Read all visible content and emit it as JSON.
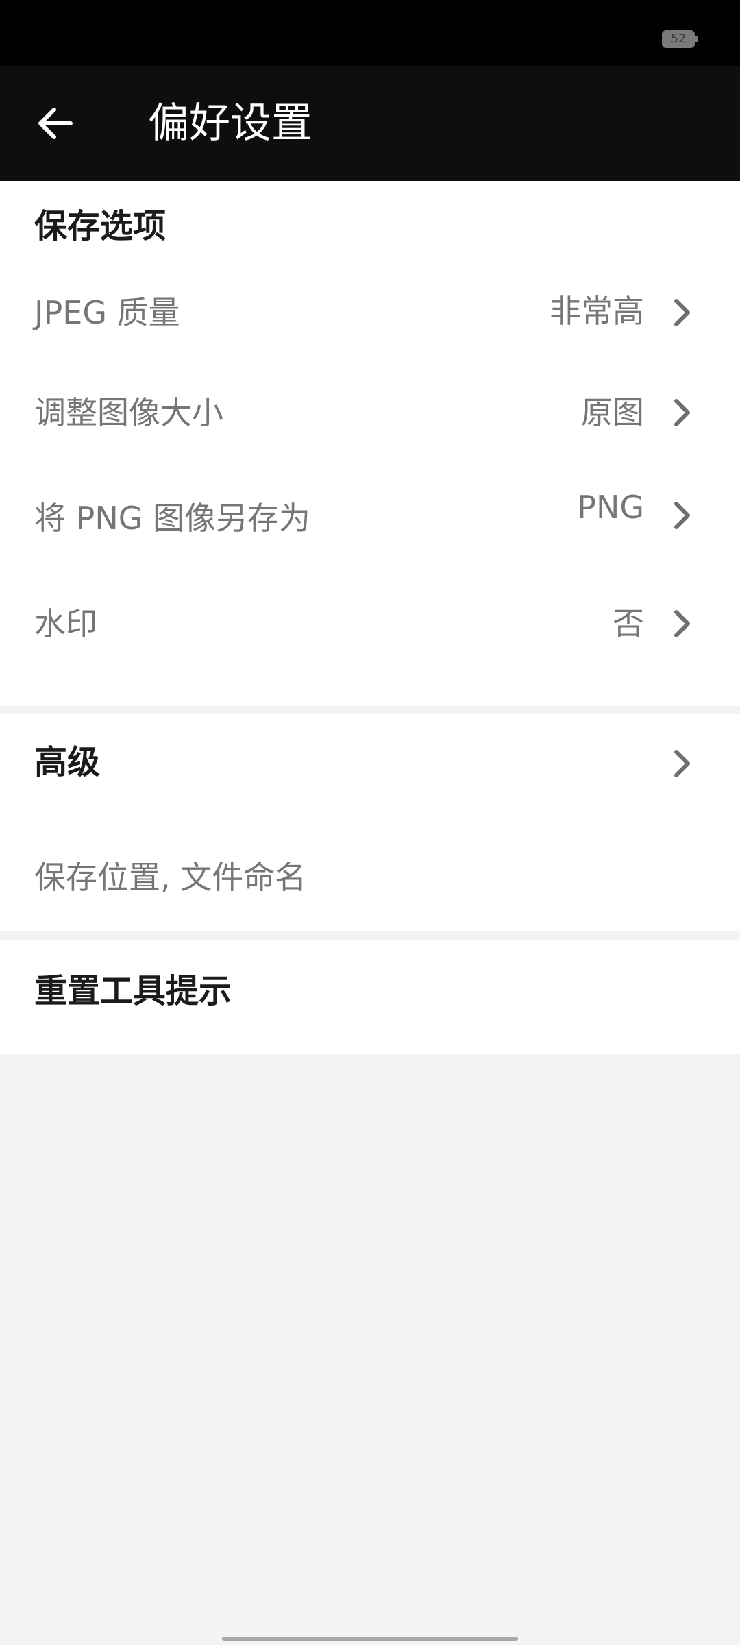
{
  "status_bar": {
    "battery_level": "52"
  },
  "app_bar": {
    "back_icon": "arrow-left-icon",
    "title": "偏好设置"
  },
  "save_options": {
    "header": "保存选项",
    "items": [
      {
        "label": "JPEG 质量",
        "value": "非常高"
      },
      {
        "label": "调整图像大小",
        "value": "原图"
      },
      {
        "label": "将 PNG 图像另存为",
        "value": "PNG"
      },
      {
        "label": "水印",
        "value": "否"
      }
    ]
  },
  "advanced": {
    "header": "高级",
    "subtitle": "保存位置, 文件命名"
  },
  "reset_tips": {
    "header": "重置工具提示"
  },
  "colors": {
    "status_bar_bg": "#000000",
    "app_bar_bg": "#0e0e0e",
    "page_bg": "#f3f3f3",
    "card_bg": "#ffffff",
    "secondary_text": "#767676",
    "header_text": "#1b1b1b"
  }
}
